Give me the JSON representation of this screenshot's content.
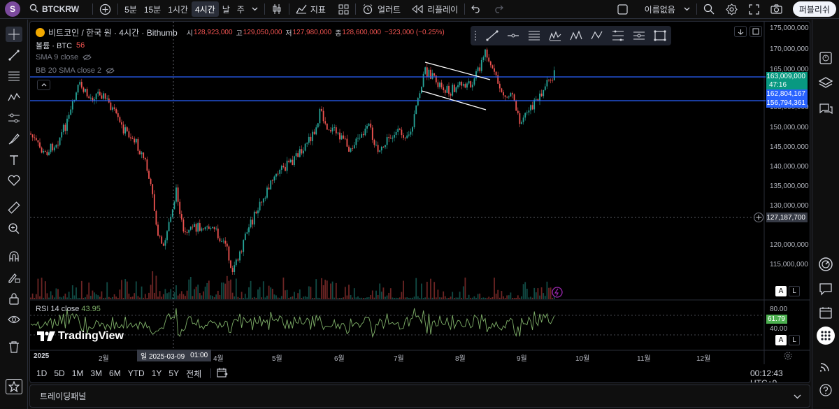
{
  "topbar": {
    "avatar_letter": "S",
    "symbol": "BTCKRW",
    "intervals": [
      "5분",
      "15분",
      "1시간",
      "4시간",
      "날",
      "주"
    ],
    "active_interval": "4시간",
    "indicators_label": "지표",
    "alert_label": "얼러트",
    "replay_label": "리플레이",
    "layout_name": "이름없음",
    "publish_label": "퍼블리쉬"
  },
  "legend": {
    "title": "비트코인 / 한국 원 · 4시간 · Bithumb",
    "open_label": "시",
    "open": "128,923,000",
    "high_label": "고",
    "high": "129,050,000",
    "low_label": "저",
    "low": "127,980,000",
    "close_label": "종",
    "close": "128,600,000",
    "change": "−323,000 (−0.25%)",
    "volume_label": "볼륨 · BTC",
    "volume_value": "56",
    "sma_label": "SMA 9 close",
    "bb_label": "BB 20 SMA close 2",
    "rsi_label": "RSI 14 close",
    "rsi_value": "43.95"
  },
  "price_axis": {
    "ticks": [
      "175,000,000",
      "170,000,000",
      "165,000,000",
      "155,000,000",
      "150,000,000",
      "145,000,000",
      "140,000,000",
      "135,000,000",
      "130,000,000",
      "120,000,000",
      "115,000,000"
    ],
    "current_price": "163,009,000",
    "countdown": "47:16",
    "line_label_1": "162,804,167",
    "line_label_2": "156,794,361",
    "crosshair_price": "127,187,700",
    "rsi_ticks": [
      "80.00",
      "40.00"
    ],
    "rsi_current": "61.79",
    "auto_label": "A",
    "log_label": "L"
  },
  "time_axis": {
    "labels": [
      "2025",
      "2월",
      "4월",
      "5월",
      "6월",
      "7월",
      "8월",
      "9월",
      "10월",
      "11월",
      "12월"
    ],
    "crosshair_date": "일 2025-03-09",
    "crosshair_time": "01:00"
  },
  "periods": [
    "1D",
    "5D",
    "1M",
    "3M",
    "6M",
    "YTD",
    "1Y",
    "5Y",
    "전체"
  ],
  "clock": "00:12:43 UTC+9",
  "bottom_panel_label": "트레이딩패널",
  "watermark": "TradingView",
  "colors": {
    "up": "#26a69a",
    "down": "#ef5350",
    "rsi": "#7fb069",
    "hline": "#2962ff",
    "current_price_bg": "#089981",
    "line_label_bg": "#2962ff"
  },
  "chart_data": {
    "type": "candlestick",
    "price_range": [
      110000000,
      177000000
    ],
    "series": [
      {
        "name": "비트코인 / 한국 원",
        "approx_closes_by_month": {
          "1월": 150000000,
          "2월": 140000000,
          "3월": 122000000,
          "4월": 127000000,
          "5월": 150000000,
          "6월": 145000000,
          "7월": 160000000,
          "8월": 164000000,
          "9월": 156000000
        }
      }
    ],
    "horizontal_lines": [
      162804167,
      156794361
    ],
    "rsi_range": [
      30,
      90
    ]
  }
}
